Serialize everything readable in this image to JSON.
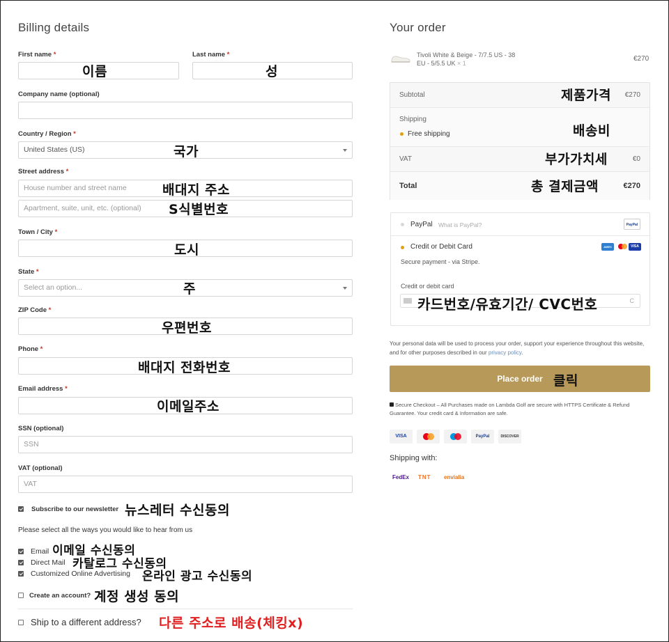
{
  "billing": {
    "heading": "Billing details",
    "first_name": {
      "label": "First name",
      "annotation": "이름"
    },
    "last_name": {
      "label": "Last name",
      "annotation": "성"
    },
    "company": {
      "label": "Company name (optional)"
    },
    "country": {
      "label": "Country / Region",
      "value": "United States (US)",
      "annotation": "국가"
    },
    "street": {
      "label": "Street address",
      "placeholder1": "House number and street name",
      "placeholder2": "Apartment, suite, unit, etc. (optional)",
      "annotation1": "배대지 주소",
      "annotation2": "S식별번호"
    },
    "city": {
      "label": "Town / City",
      "annotation": "도시"
    },
    "state": {
      "label": "State",
      "placeholder": "Select an option...",
      "annotation": "주"
    },
    "zip": {
      "label": "ZIP Code",
      "annotation": "우편번호"
    },
    "phone": {
      "label": "Phone",
      "annotation": "배대지 전화번호"
    },
    "email": {
      "label": "Email address",
      "annotation": "이메일주소"
    },
    "ssn": {
      "label": "SSN (optional)",
      "placeholder": "SSN"
    },
    "vat": {
      "label": "VAT (optional)",
      "placeholder": "VAT"
    },
    "required_mark": "*",
    "newsletter": {
      "label": "Subscribe to our newsletter",
      "annotation": "뉴스레터 수신동의"
    },
    "hear_from_us": "Please select all the ways you would like to hear from us",
    "opt_email": {
      "label": "Email",
      "annotation": "이메일 수신동의"
    },
    "opt_mail": {
      "label": "Direct Mail",
      "annotation": "카탈로그 수신동의"
    },
    "opt_ads": {
      "label": "Customized Online Advertising",
      "annotation": "온라인 광고 수신동의"
    },
    "create_account": {
      "label": "Create an account?",
      "annotation": "계정 생성 동의"
    },
    "ship_diff": {
      "label": "Ship to a different address?",
      "annotation": "다른 주소로 배송(체킹x)"
    }
  },
  "order": {
    "heading": "Your order",
    "product": {
      "name": "Tivoli White & Beige - 7/7.5 US - 38",
      "variant": "EU - 5/5.5 UK",
      "qty": "× 1",
      "price": "€270"
    },
    "subtotal": {
      "label": "Subtotal",
      "value": "€270",
      "annotation": "제품가격"
    },
    "shipping": {
      "label": "Shipping",
      "option": "Free shipping",
      "annotation": "배송비"
    },
    "vat": {
      "label": "VAT",
      "value": "€0",
      "annotation": "부가가치세"
    },
    "total": {
      "label": "Total",
      "value": "€270",
      "annotation": "총 결제금액"
    },
    "paypal": {
      "label": "PayPal",
      "link": "What is PayPal?",
      "badge": "PayPal"
    },
    "card": {
      "label": "Credit or Debit Card",
      "note": "Secure payment - via Stripe.",
      "field_label": "Credit or debit card",
      "annotation": "카드번호/유효기간/ CVC번호",
      "cvc_tail": "C",
      "brands": [
        "AMEX",
        "MC",
        "VISA"
      ]
    },
    "privacy": {
      "text": "Your personal data will be used to process your order, support your experience throughout this website, and for other purposes described in our",
      "link": "privacy policy",
      "end": "."
    },
    "place_order": {
      "label": "Place order",
      "annotation": "클릭"
    },
    "secure": "Secure Checkout – All Purchases made on Lambda Golf are secure with HTTPS Certificate & Refund Guarantee. Your credit card & Information are safe.",
    "badges": [
      "VISA",
      "MC",
      "Maestro",
      "PayPal",
      "DISCOVER"
    ],
    "shipping_with": "Shipping with:",
    "carriers": [
      "FedEx",
      "TNT",
      "envialia"
    ]
  },
  "colors": {
    "accent": "#b79a5a",
    "required": "#c0392b",
    "annotation_red": "#e02020",
    "bullet": "#e0a010"
  }
}
